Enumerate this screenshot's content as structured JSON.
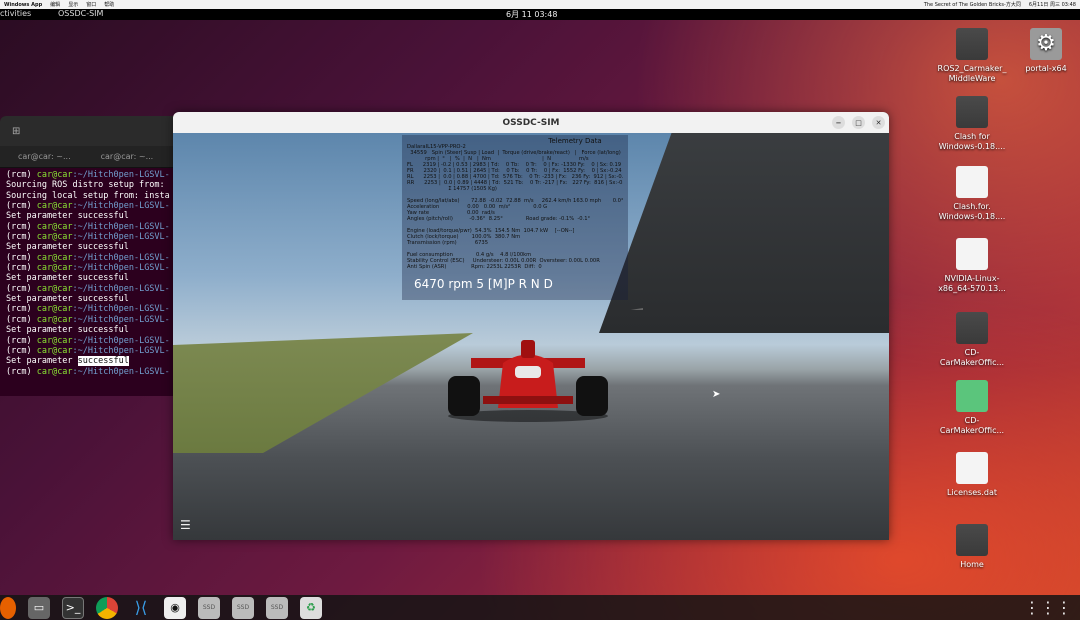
{
  "macbar": {
    "app": "Windows App",
    "menus": [
      "编辑",
      "显示",
      "窗口",
      "帮助"
    ],
    "song": "The Secret of The Golden Bricks-方大同",
    "datetime": "6月11日 周三 03:48"
  },
  "topbar": {
    "activities": "ctivities",
    "app_name": "OSSDC-SIM",
    "clock": "6月 11  03:48"
  },
  "terminal": {
    "tabs": [
      "car@car: ~...",
      "car@car: ~..."
    ],
    "lines": [
      {
        "p": "(rcm) ",
        "u": "car@car",
        "path": ":~/Hitch0pen-LGSVL-",
        "t": ""
      },
      {
        "p": "Sourcing ROS distro setup from:",
        "u": "",
        "path": "",
        "t": ""
      },
      {
        "p": "Sourcing local setup from: insta",
        "u": "",
        "path": "",
        "t": ""
      },
      {
        "p": "(rcm) ",
        "u": "car@car",
        "path": ":~/Hitch0pen-LGSVL-",
        "t": ""
      },
      {
        "p": "Set parameter successful",
        "u": "",
        "path": "",
        "t": ""
      },
      {
        "p": "(rcm) ",
        "u": "car@car",
        "path": ":~/Hitch0pen-LGSVL-",
        "t": ""
      },
      {
        "p": "(rcm) ",
        "u": "car@car",
        "path": ":~/Hitch0pen-LGSVL-",
        "t": ""
      },
      {
        "p": "Set parameter successful",
        "u": "",
        "path": "",
        "t": ""
      },
      {
        "p": "(rcm) ",
        "u": "car@car",
        "path": ":~/Hitch0pen-LGSVL-",
        "t": ""
      },
      {
        "p": "(rcm) ",
        "u": "car@car",
        "path": ":~/Hitch0pen-LGSVL-",
        "t": ""
      },
      {
        "p": "Set parameter successful",
        "u": "",
        "path": "",
        "t": ""
      },
      {
        "p": "(rcm) ",
        "u": "car@car",
        "path": ":~/Hitch0pen-LGSVL-",
        "t": ""
      },
      {
        "p": "Set parameter successful",
        "u": "",
        "path": "",
        "t": ""
      },
      {
        "p": "(rcm) ",
        "u": "car@car",
        "path": ":~/Hitch0pen-LGSVL-",
        "t": ""
      },
      {
        "p": "(rcm) ",
        "u": "car@car",
        "path": ":~/Hitch0pen-LGSVL-",
        "t": ""
      },
      {
        "p": "Set parameter successful",
        "u": "",
        "path": "",
        "t": ""
      },
      {
        "p": "(rcm) ",
        "u": "car@car",
        "path": ":~/Hitch0pen-LGSVL-",
        "t": ""
      },
      {
        "p": "(rcm) ",
        "u": "car@car",
        "path": ":~/Hitch0pen-LGSVL-",
        "t": ""
      },
      {
        "p": "Set parameter ",
        "u": "",
        "path": "",
        "t": "successful"
      },
      {
        "p": "(rcm) ",
        "u": "car@car",
        "path": ":~/Hitch0pen-LGSVL-",
        "t": ""
      }
    ]
  },
  "sim": {
    "title": "OSSDC-SIM",
    "hud": {
      "title": "Telemetry Data",
      "lines": [
        "DallaraIL15-VPP-PRO-2",
        "  34559   Spin (Steer| Susp | Load  |  Torque (drive/brake/react)   |   Force (lat/long)   |  Slip (lat/long/comb)",
        "           rpm |  °   |  %  |  N   |  Nm                               |  N                 m/s",
        "FL      2319 | -0.2 | 0.53 | 2983 | Td:    0 Tb:    0 Tr:    0 | Fx: -1330 Fy:    0 | Sx: 0.19 Sy: 0.00 Sc: 0.00",
        "FR      2320 |  0.1 | 0.51 | 2645 | Td:    0 Tb:    0 Tr:    0 | Fx:  1552 Fy:    0 | Sx:-0.24 Sy: 0.00 Sc: 0.00",
        "RL      2253 |  0.0 | 0.88 | 4700 | Td:  576 Tb:    0 Tr: -233 | Fx:   236 Fy:  912 | Sx:-0.02 Sy:-0.27 Sc: 0.27",
        "RR      2253 |  0.0 | 0.89 | 4448 | Td:  521 Tb:    0 Tr: -217 | Fx:   227 Fy:  816 | Sx:-0.02 Sy:-0.25 Sc: 0.25",
        "                         Σ 14757 (1505 Kg)",
        "",
        "Speed (long/lat/abs)       72.88  -0.02  72.88  m/s     262.4 km/h 163.0 mph       0.0°",
        "Acceleration                 0.00   0.00  m/s²              0.0 G",
        "Yaw rate                       0.00  rad/s",
        "Angles (pitch/roll)          -0.36°  8.25°              Road grade: -0.1%  -0.1°",
        "",
        "Engine (load/torque/pwr)  54.3%  154.5 Nm  104.7 kW    [--ON--]",
        "Clutch (lock/torque)        100.0%  380.7 Nm",
        "Transmission (rpm)           6735",
        "",
        "Fuel consumption              0.4 g/s    4.8 l/100km",
        "Stability Control (ESC)     Understeer: 0.00L 0.00R  Oversteer: 0.00L 0.00R",
        "Anti Spin (ASR)               Rpm: 2253L 2253R  Diff:  0"
      ],
      "rpm_line": "6470 rpm   5   [M]P R N D"
    }
  },
  "desktop": {
    "icons": [
      {
        "label": "ROS2_Carmaker_\nMiddleWare",
        "kind": "folder"
      },
      {
        "label": "portal-x64",
        "kind": "gear"
      },
      {
        "label": "Clash for\nWindows-0.18....",
        "kind": "folder"
      },
      {
        "label": "Clash.for.\nWindows-0.18....",
        "kind": "zipdoc"
      },
      {
        "label": "NVIDIA-Linux-\nx86_64-570.13...",
        "kind": "script"
      },
      {
        "label": "CD-\nCarMakerOffic...",
        "kind": "folder"
      },
      {
        "label": "CD-\nCarMakerOffic...",
        "kind": "zip"
      },
      {
        "label": "Licenses.dat",
        "kind": "doc"
      },
      {
        "label": "Home",
        "kind": "folder"
      }
    ]
  },
  "dock": {
    "items": [
      "firefox-icon",
      "files-icon",
      "terminal-icon",
      "chrome-icon",
      "vscode-icon",
      "ossdc-icon",
      "ssd-icon",
      "ssd-icon",
      "ssd-icon",
      "trash-icon"
    ],
    "ssd_label": "SSD",
    "apps_grid": "⋮⋮⋮"
  }
}
